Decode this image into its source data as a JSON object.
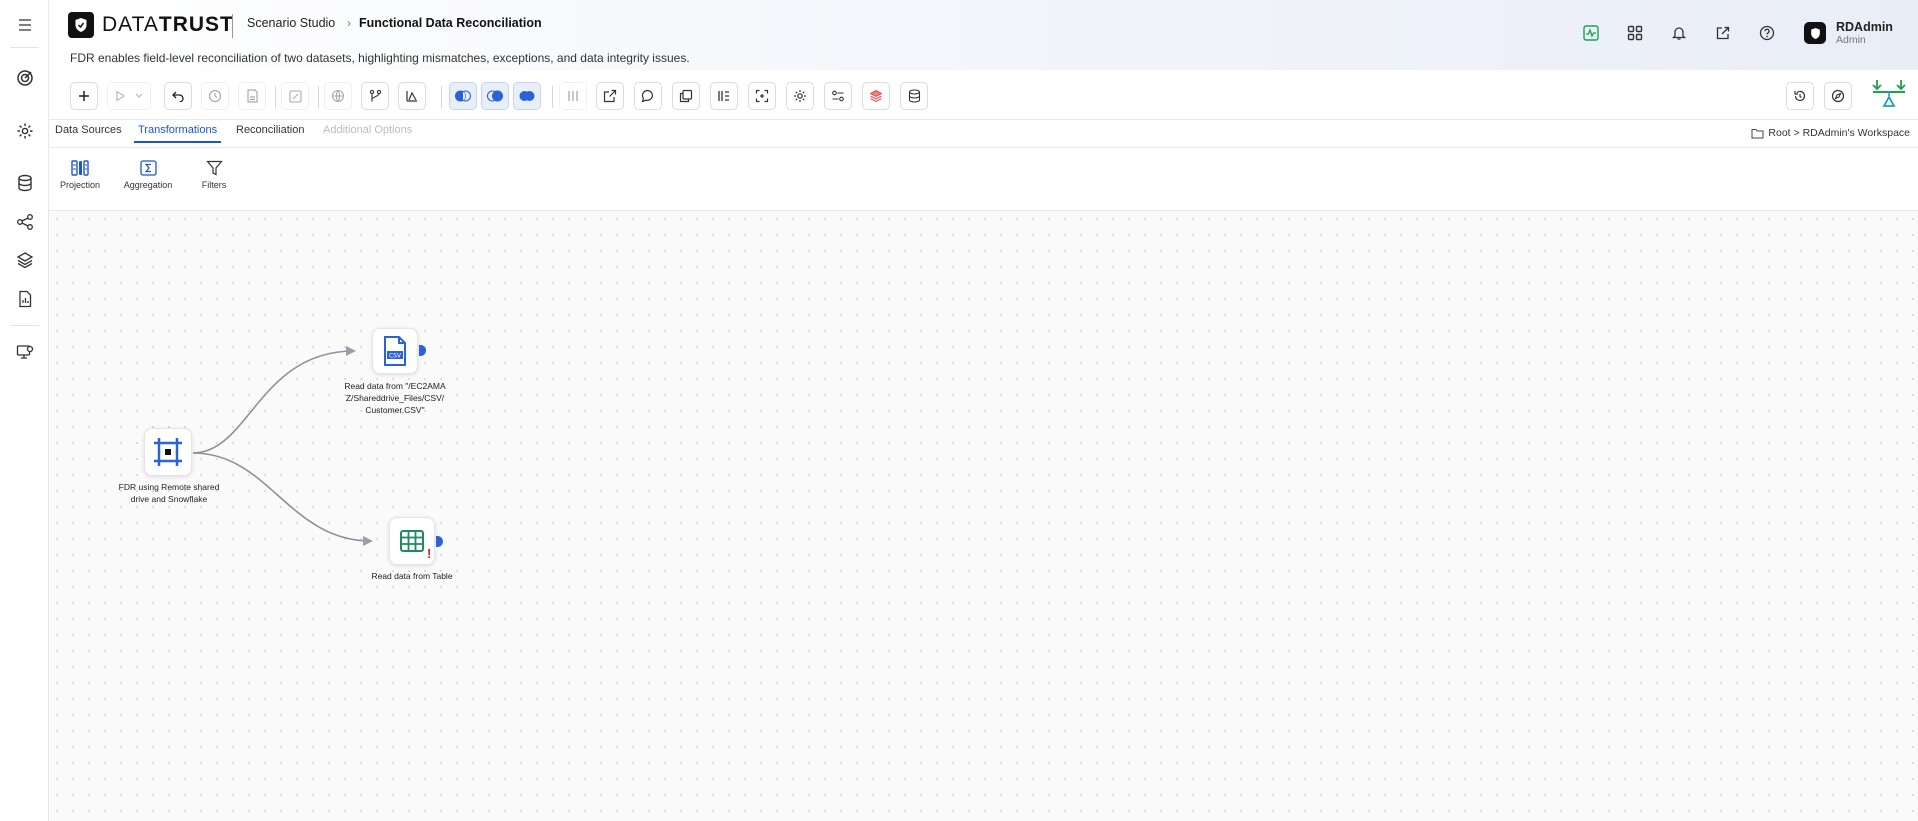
{
  "app": {
    "logo_brand_light": "DATA",
    "logo_brand_bold": "TRUST",
    "breadcrumb_parent": "Scenario Studio",
    "breadcrumb_current": "Functional Data Reconciliation",
    "subtitle": "FDR enables field-level reconciliation of two datasets, highlighting mismatches, exceptions, and data integrity issues."
  },
  "user": {
    "name": "RDAdmin",
    "role": "Admin"
  },
  "tabs": {
    "data_sources": "Data Sources",
    "transformations": "Transformations",
    "reconciliation": "Reconciliation",
    "additional_options": "Additional Options",
    "active": "Transformations"
  },
  "workspace_path": "Root > RDAdmin's Workspace",
  "palette": {
    "projection": "Projection",
    "aggregation": "Aggregation",
    "filters": "Filters"
  },
  "nodes": {
    "start": "FDR using Remote shared drive and Snowflake",
    "csv_line1": "Read data from \"/EC2AMA",
    "csv_line2": "Z/Shareddrive_Files/CSV/",
    "csv_line3": "Customer.CSV\"",
    "table": "Read data from Table"
  },
  "colors": {
    "accent": "#1e56c8",
    "node_icon_blue": "#2a63d6",
    "table_icon_green": "#1f8a5b",
    "warning_red": "#d12020",
    "balance_green": "#1aa34a",
    "balance_teal": "#1fa3a8"
  },
  "icons": {
    "rail": [
      "menu-icon",
      "target-icon",
      "gear-icon",
      "database-icon",
      "share-nodes-icon",
      "layers-icon",
      "report-icon",
      "monitor-settings-icon"
    ],
    "header": [
      "activity-icon",
      "apps-grid-icon",
      "bell-icon",
      "external-link-icon",
      "help-icon"
    ]
  }
}
